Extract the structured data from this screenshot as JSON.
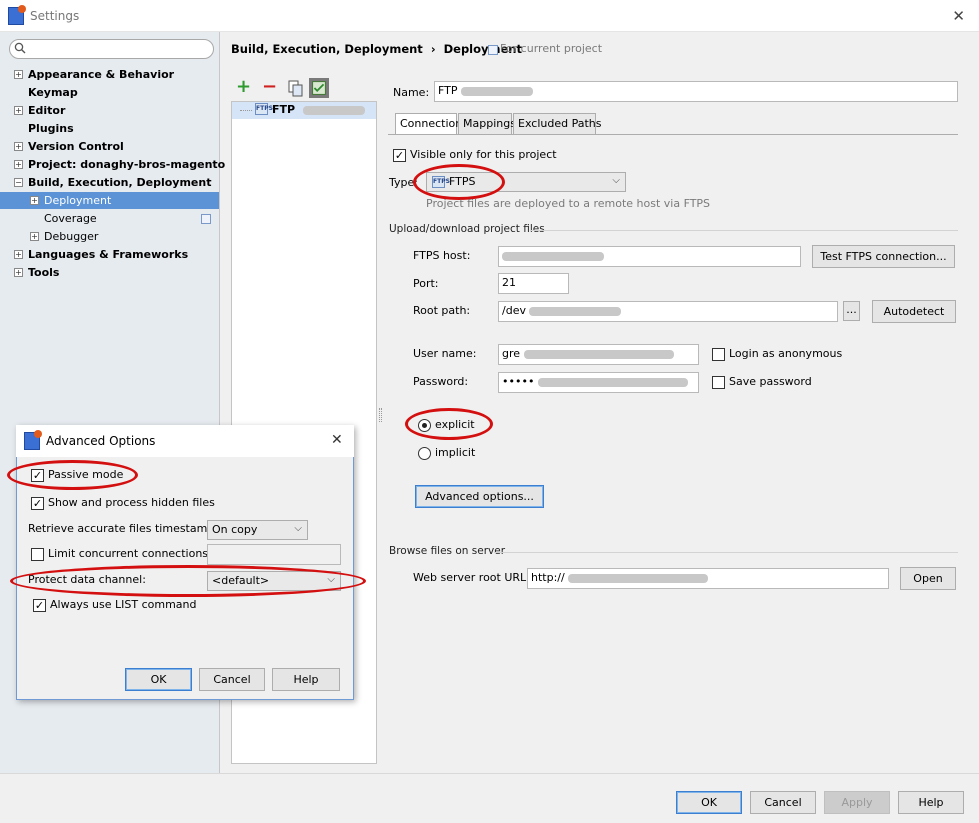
{
  "window": {
    "title": "Settings",
    "close_glyph": "✕"
  },
  "search": {
    "placeholder": ""
  },
  "nav": {
    "items": [
      {
        "label": "Appearance & Behavior",
        "expand": "+"
      },
      {
        "label": "Keymap"
      },
      {
        "label": "Editor",
        "expand": "+"
      },
      {
        "label": "Plugins"
      },
      {
        "label": "Version Control",
        "expand": "+"
      },
      {
        "label": "Project: donaghy-bros-magento",
        "expand": "+"
      },
      {
        "label": "Build, Execution, Deployment",
        "expand": "−"
      },
      {
        "label": "Deployment",
        "expand": "+",
        "selected": true
      },
      {
        "label": "Coverage"
      },
      {
        "label": "Debugger",
        "expand": "+"
      },
      {
        "label": "Languages & Frameworks",
        "expand": "+"
      },
      {
        "label": "Tools",
        "expand": "+"
      }
    ]
  },
  "breadcrumb": {
    "parent": "Build, Execution, Deployment",
    "separator": "›",
    "current": "Deployment",
    "note": "For current project"
  },
  "toolbar": {
    "add": "+",
    "remove": "−"
  },
  "server_list": {
    "items": [
      {
        "name": "FTP",
        "icon": "ftps-icon"
      }
    ]
  },
  "form": {
    "name_label": "Name:",
    "name_value": "FTP",
    "tabs": [
      {
        "label": "Connection",
        "active": true
      },
      {
        "label": "Mappings"
      },
      {
        "label": "Excluded Paths"
      }
    ],
    "visible_only_label": "Visible only for this project",
    "visible_only_checked": true,
    "type_label": "Type:",
    "type_value": "FTPS",
    "type_hint": "Project files are deployed to a remote host via FTPS",
    "upload_section": "Upload/download project files",
    "host_label": "FTPS host:",
    "test_button": "Test FTPS connection...",
    "port_label": "Port:",
    "port_value": "21",
    "root_label": "Root path:",
    "root_value": "/dev",
    "browse_button": "...",
    "autodetect_button": "Autodetect",
    "user_label": "User name:",
    "user_value": "gre",
    "anon_label": "Login as anonymous",
    "password_label": "Password:",
    "password_value": "•••••",
    "save_pw_label": "Save password",
    "explicit_label": "explicit",
    "implicit_label": "implicit",
    "advanced_button": "Advanced options...",
    "browse_section": "Browse files on server",
    "web_root_label": "Web server root URL:",
    "web_root_value": "http://",
    "open_button": "Open"
  },
  "dialog": {
    "title": "Advanced Options",
    "close_glyph": "✕",
    "passive_label": "Passive mode",
    "passive_checked": true,
    "hidden_label": "Show and process hidden files",
    "hidden_checked": true,
    "timestamps_label": "Retrieve accurate files timestamps:",
    "timestamps_value": "On copy",
    "limit_label": "Limit concurrent connections:",
    "limit_checked": false,
    "protect_label": "Protect data channel:",
    "protect_value": "<default>",
    "list_label": "Always use LIST command",
    "list_checked": true,
    "ok": "OK",
    "cancel": "Cancel",
    "help": "Help"
  },
  "footer": {
    "ok": "OK",
    "cancel": "Cancel",
    "apply": "Apply",
    "help": "Help"
  },
  "colors": {
    "selection": "#5b93d6",
    "annotation": "#d40f0f",
    "accent": "#3c7fd1"
  }
}
